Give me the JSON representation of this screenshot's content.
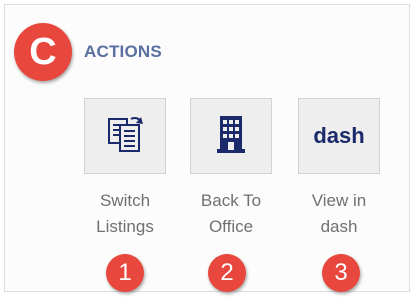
{
  "section": {
    "marker": "C",
    "title": "ACTIONS"
  },
  "actions": [
    {
      "label": "Switch\nListings",
      "icon": "switch-listings-icon",
      "marker": "1"
    },
    {
      "label": "Back To\nOffice",
      "icon": "office-building-icon",
      "marker": "2"
    },
    {
      "label": "View in\ndash",
      "icon": "dash-logo-icon",
      "icon_text": "dash",
      "marker": "3"
    }
  ],
  "colors": {
    "marker": "#e8473d",
    "title": "#5a6fa0",
    "icon": "#1b2a6b",
    "label": "#707070"
  }
}
